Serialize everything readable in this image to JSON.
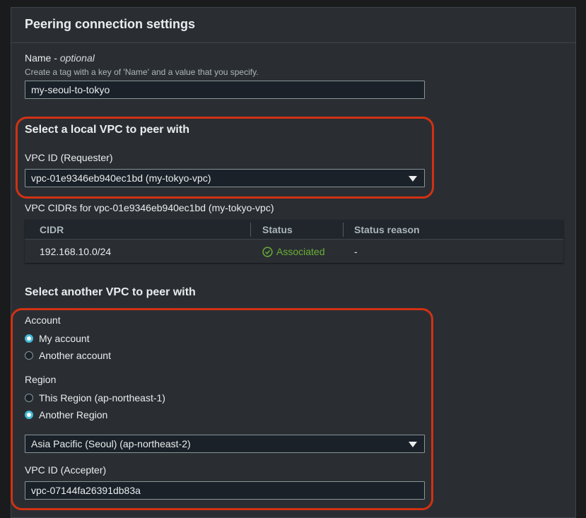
{
  "panel": {
    "title": "Peering connection settings"
  },
  "name_field": {
    "label": "Name",
    "optional": "optional",
    "separator": " - ",
    "hint": "Create a tag with a key of 'Name' and a value that you specify.",
    "value": "my-seoul-to-tokyo"
  },
  "local_vpc": {
    "section_title": "Select a local VPC to peer with",
    "vpc_id_label": "VPC ID (Requester)",
    "vpc_id_value": "vpc-01e9346eb940ec1bd (my-tokyo-vpc)"
  },
  "cidr_table": {
    "caption": "VPC CIDRs for vpc-01e9346eb940ec1bd (my-tokyo-vpc)",
    "columns": [
      "CIDR",
      "Status",
      "Status reason"
    ],
    "rows": [
      {
        "cidr": "192.168.10.0/24",
        "status": "Associated",
        "reason": "-"
      }
    ]
  },
  "another_vpc": {
    "section_title": "Select another VPC to peer with",
    "account_label": "Account",
    "account_options": [
      "My account",
      "Another account"
    ],
    "account_selected": "My account",
    "region_label": "Region",
    "region_options": [
      "This Region (ap-northeast-1)",
      "Another Region"
    ],
    "region_selected": "Another Region",
    "region_select_value": "Asia Pacific (Seoul) (ap-northeast-2)",
    "accepter_label": "VPC ID (Accepter)",
    "accepter_value": "vpc-07144fa26391db83a"
  },
  "colors": {
    "highlight": "#d13212",
    "status_ok": "#6aaf35",
    "radio_selected": "#44b9d6"
  },
  "icons": {
    "dropdown": "caret-down-icon",
    "status": "check-circle-icon"
  }
}
